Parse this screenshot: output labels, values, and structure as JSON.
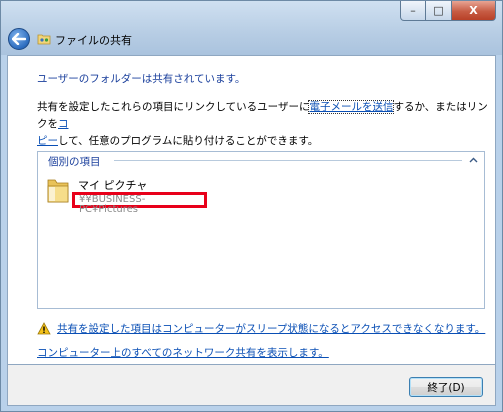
{
  "window": {
    "title": "ファイルの共有",
    "controls": {
      "minimize": "–",
      "maximize": "□",
      "close": "X"
    }
  },
  "main": {
    "heading": "ユーザーのフォルダーは共有されています。",
    "desc_part1": "共有を設定したこれらの項目にリンクしているユーザーに",
    "email_link": "電子メールを送信",
    "desc_part2": "するか、またはリンクを",
    "copy_link_1": "コ",
    "copy_link_2": "ピー",
    "desc_part3": "して、任意のプログラムに貼り付けることができます。",
    "group": {
      "label": "個別の項目",
      "item_name": "マイ ピクチャ",
      "item_path": "¥¥BUSINESS-PC¥Pictures"
    },
    "warning_link": "共有を設定した項目はコンピューターがスリープ状態になるとアクセスできなくなります。",
    "all_shares_link": "コンピューター上のすべてのネットワーク共有を表示します。"
  },
  "footer": {
    "close_button": "終了(D)"
  },
  "colors": {
    "link": "#0a4fb5",
    "heading": "#1a3f9c",
    "highlight_box": "#e8001a"
  }
}
